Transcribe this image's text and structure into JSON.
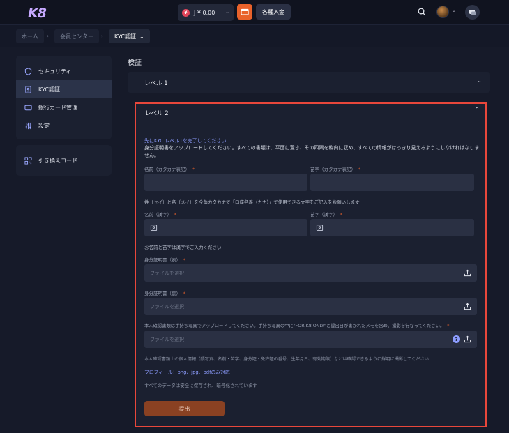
{
  "header": {
    "logo": "K8",
    "balance_currency_icon": "¥",
    "balance": "J ¥ 0.00",
    "deposit_label": "各種入金"
  },
  "breadcrumb": [
    "ホーム",
    "会員センター",
    "KYC認証"
  ],
  "sidebar": {
    "items": [
      {
        "label": "セキュリティ",
        "icon": "shield-icon"
      },
      {
        "label": "KYC認証",
        "icon": "id-card-icon"
      },
      {
        "label": "銀行カード管理",
        "icon": "credit-card-icon"
      },
      {
        "label": "設定",
        "icon": "sliders-icon"
      }
    ],
    "redeem": {
      "label": "引き換えコード",
      "icon": "qr-code-icon"
    }
  },
  "main": {
    "title": "検証",
    "level1": {
      "label": "レベル 1"
    },
    "level2": {
      "label": "レベル 2",
      "hint": "先にKYC レベル1を完了してください",
      "instructions": "身分証明書をアップロードしてください。すべての書類は、平面に置き、その四隅を枠内に収め、すべての情報がはっきり見えるようにしなければなりません。",
      "name_kana_label": "名前（カタカナ表記）",
      "surname_kana_label": "苗字（カタカナ表記）",
      "kana_note": "姓（セイ）と名（メイ）を全角カタカナで「口座名義（カナ）」で使用できる文字をご記入をお願いします",
      "name_kanji_label": "名前（漢字）",
      "surname_kanji_label": "苗字（漢字）",
      "kanji_note": "お名前と苗字は漢字でご入力ください",
      "id_front_label": "身分証明書（表）",
      "id_back_label": "身分証明書（裏）",
      "selfie_label": "本人確認書類は手持ち写真でアップロードしてください。手持ち写真の中に\"FOR K8 ONLY\"と提出日が書かれたメモを含め、撮影を行なってください。",
      "file_placeholder": "ファイルを選択",
      "personal_info_note": "本人確認書類上の個人情報（顔写真、名前・苗字、身分証・免許証の番号、生年月日、有効期限）などは確認できるように鮮明に撮影してください",
      "formats_note": "プロフィール：png、jpg、pdfのみ対応",
      "security_note": "すべてのデータは安全に保存され、暗号化されています",
      "submit_label": "提出"
    }
  }
}
